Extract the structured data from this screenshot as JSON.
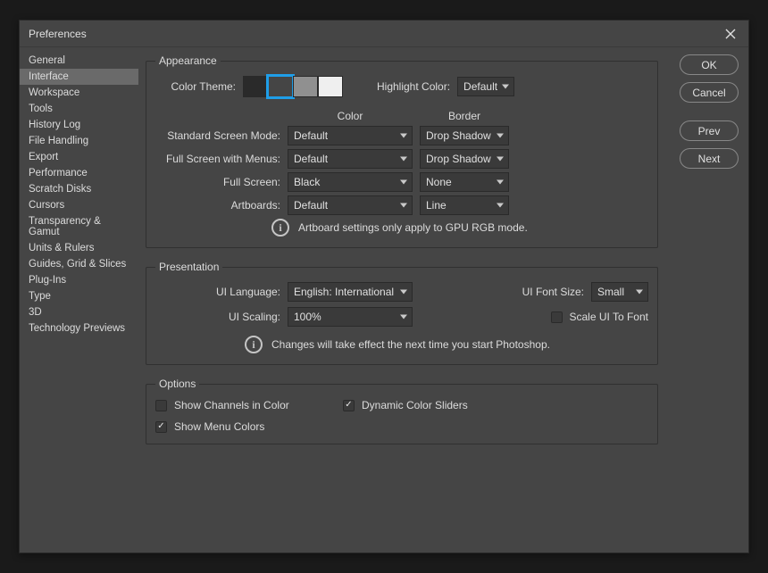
{
  "window": {
    "title": "Preferences"
  },
  "sidebar": {
    "selected_index": 1,
    "items": [
      "General",
      "Interface",
      "Workspace",
      "Tools",
      "History Log",
      "File Handling",
      "Export",
      "Performance",
      "Scratch Disks",
      "Cursors",
      "Transparency & Gamut",
      "Units & Rulers",
      "Guides, Grid & Slices",
      "Plug-Ins",
      "Type",
      "3D",
      "Technology Previews"
    ]
  },
  "buttons": {
    "ok": "OK",
    "cancel": "Cancel",
    "prev": "Prev",
    "next": "Next"
  },
  "appearance": {
    "legend": "Appearance",
    "color_theme_label": "Color Theme:",
    "theme_colors": [
      "#2a2a2a",
      "#454545",
      "#909090",
      "#efefef"
    ],
    "theme_selected_index": 1,
    "highlight_label": "Highlight Color:",
    "highlight_value": "Default",
    "col_color": "Color",
    "col_border": "Border",
    "rows": [
      {
        "label": "Standard Screen Mode:",
        "color": "Default",
        "border": "Drop Shadow"
      },
      {
        "label": "Full Screen with Menus:",
        "color": "Default",
        "border": "Drop Shadow"
      },
      {
        "label": "Full Screen:",
        "color": "Black",
        "border": "None"
      },
      {
        "label": "Artboards:",
        "color": "Default",
        "border": "Line"
      }
    ],
    "info": "Artboard settings only apply to GPU RGB mode."
  },
  "presentation": {
    "legend": "Presentation",
    "ui_language_label": "UI Language:",
    "ui_language_value": "English: International",
    "ui_font_size_label": "UI Font Size:",
    "ui_font_size_value": "Small",
    "ui_scaling_label": "UI Scaling:",
    "ui_scaling_value": "100%",
    "scale_ui_label": "Scale UI To Font",
    "scale_ui_checked": false,
    "info": "Changes will take effect the next time you start Photoshop."
  },
  "options": {
    "legend": "Options",
    "items": [
      {
        "label": "Show Channels in Color",
        "checked": false
      },
      {
        "label": "Dynamic Color Sliders",
        "checked": true
      },
      {
        "label": "Show Menu Colors",
        "checked": true
      }
    ]
  }
}
